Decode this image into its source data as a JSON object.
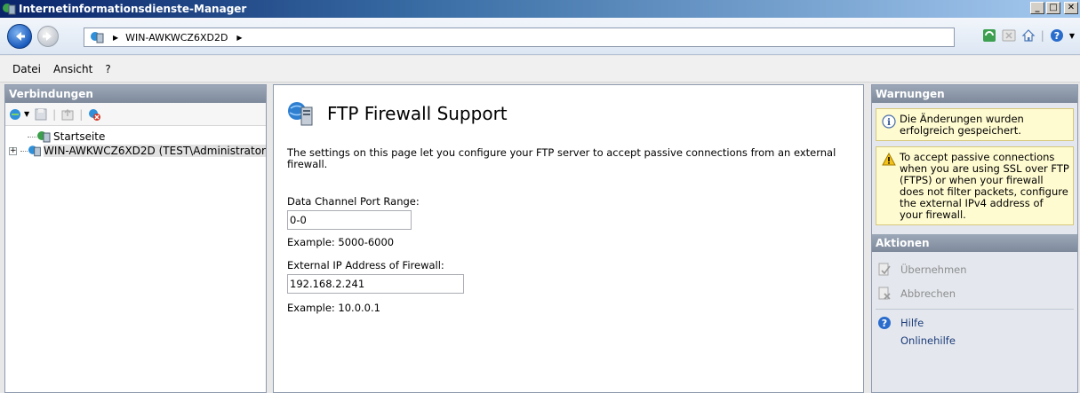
{
  "window": {
    "title": "Internetinformationsdienste-Manager",
    "buttons": {
      "minimize": "_",
      "maximize": "□",
      "close": "✕"
    }
  },
  "address": {
    "server": "WIN-AWKWCZ6XD2D",
    "separator": "▶"
  },
  "menu": {
    "items": [
      "Datei",
      "Ansicht",
      "?"
    ]
  },
  "connections": {
    "title": "Verbindungen",
    "tree": [
      {
        "label": "Startseite",
        "expander": ""
      },
      {
        "label": "WIN-AWKWCZ6XD2D (TEST\\Administrator",
        "expander": "+"
      }
    ]
  },
  "main": {
    "title": "FTP Firewall Support",
    "description": "The settings on this page let you configure your FTP server to accept passive connections from an external firewall.",
    "port_range": {
      "label": "Data Channel Port Range:",
      "value": "0-0",
      "example": "Example: 5000-6000"
    },
    "external_ip": {
      "label": "External IP Address of Firewall:",
      "value": "192.168.2.241",
      "example": "Example: 10.0.0.1"
    }
  },
  "alerts": {
    "title": "Warnungen",
    "info_text": "Die Änderungen wurden erfolgreich gespeichert.",
    "warning_text": "To accept passive connections when you are using SSL over FTP (FTPS) or when your firewall does not filter packets, configure the external IPv4 address of your firewall."
  },
  "actions": {
    "title": "Aktionen",
    "apply": "Übernehmen",
    "cancel": "Abbrechen",
    "help": "Hilfe",
    "online_help": "Onlinehilfe"
  },
  "colors": {
    "panel_header": "#8b97a8",
    "warning_bg": "#fffbd0",
    "link": "#1c3c7a"
  }
}
